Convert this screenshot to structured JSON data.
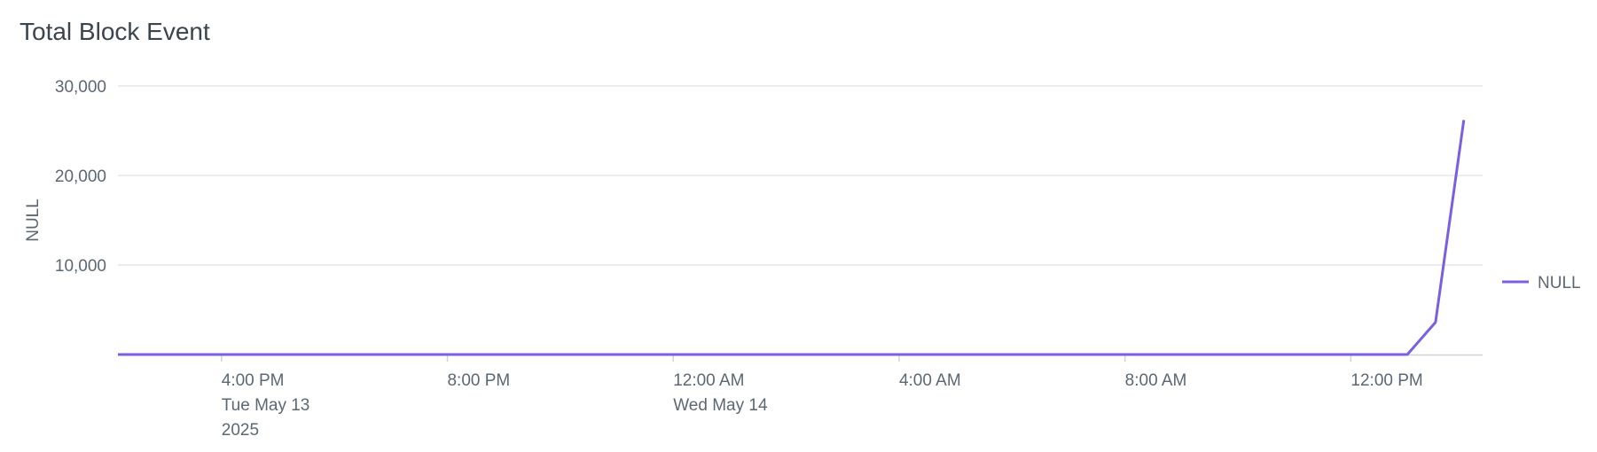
{
  "chart_data": {
    "type": "line",
    "title": "Total Block Event",
    "xlabel": "",
    "ylabel": "NULL",
    "ylim": [
      0,
      30000
    ],
    "y_ticks": [
      10000,
      20000,
      30000
    ],
    "y_tick_labels": [
      "10,000",
      "20,000",
      "30,000"
    ],
    "x_range": [
      "2025-05-13T14:10",
      "2025-05-14T13:45"
    ],
    "x_ticks": [
      {
        "time": "2025-05-13T16:00",
        "lines": [
          "4:00 PM",
          "Tue May 13",
          "2025"
        ]
      },
      {
        "time": "2025-05-13T20:00",
        "lines": [
          "8:00 PM"
        ]
      },
      {
        "time": "2025-05-14T00:00",
        "lines": [
          "12:00 AM",
          "Wed May 14"
        ]
      },
      {
        "time": "2025-05-14T04:00",
        "lines": [
          "4:00 AM"
        ]
      },
      {
        "time": "2025-05-14T08:00",
        "lines": [
          "8:00 AM"
        ]
      },
      {
        "time": "2025-05-14T12:00",
        "lines": [
          "12:00 PM"
        ]
      }
    ],
    "grid": true,
    "legend_position": "right",
    "series": [
      {
        "name": "NULL",
        "color": "#7b5fe0",
        "points": [
          {
            "x": "2025-05-13T14:10",
            "y": 0
          },
          {
            "x": "2025-05-14T13:00",
            "y": 0
          },
          {
            "x": "2025-05-14T13:30",
            "y": 3600
          },
          {
            "x": "2025-05-14T14:00",
            "y": 26200
          }
        ]
      }
    ]
  }
}
